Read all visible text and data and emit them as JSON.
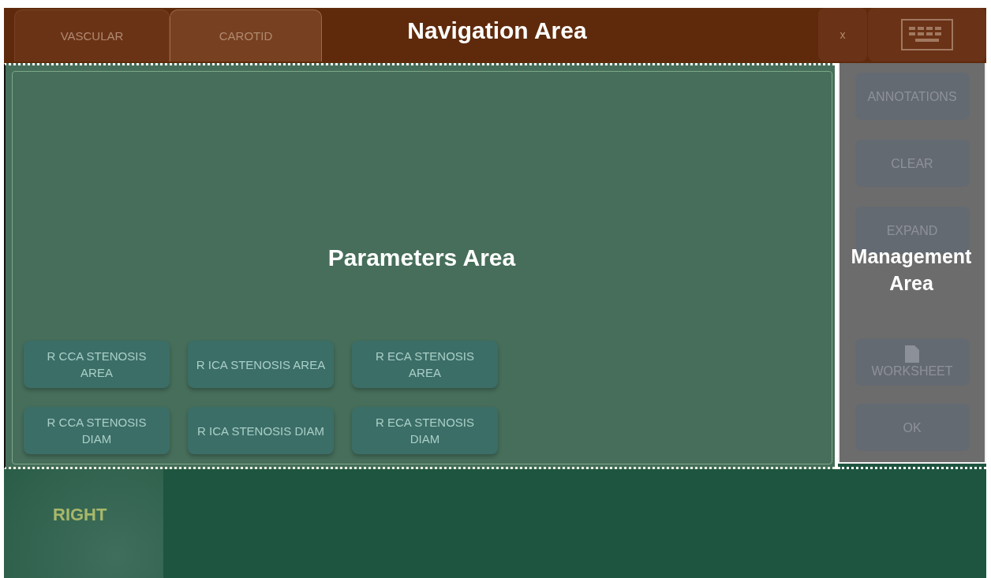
{
  "navigation": {
    "tabs": [
      {
        "label": "VASCULAR",
        "selected": false
      },
      {
        "label": "CAROTID",
        "selected": true
      }
    ],
    "label": "Navigation Area",
    "close": "x"
  },
  "parameters": {
    "label": "Parameters Area",
    "buttons": [
      {
        "label": "R CCA STENOSIS AREA"
      },
      {
        "label": "R ICA STENOSIS AREA"
      },
      {
        "label": "R ECA STENOSIS AREA"
      },
      {
        "label": "R CCA STENOSIS DIAM"
      },
      {
        "label": "R ICA STENOSIS DIAM"
      },
      {
        "label": "R ECA STENOSIS DIAM"
      }
    ]
  },
  "management": {
    "label": "Management Area",
    "buttons": [
      {
        "label": "ANNOTATIONS",
        "kind": "text"
      },
      {
        "label": "CLEAR",
        "kind": "text"
      },
      {
        "label": "EXPAND",
        "kind": "text"
      },
      {
        "label": "WORKSHEET",
        "kind": "document"
      },
      {
        "label": "OK",
        "kind": "text"
      }
    ]
  },
  "side": {
    "label": "RIGHT"
  }
}
